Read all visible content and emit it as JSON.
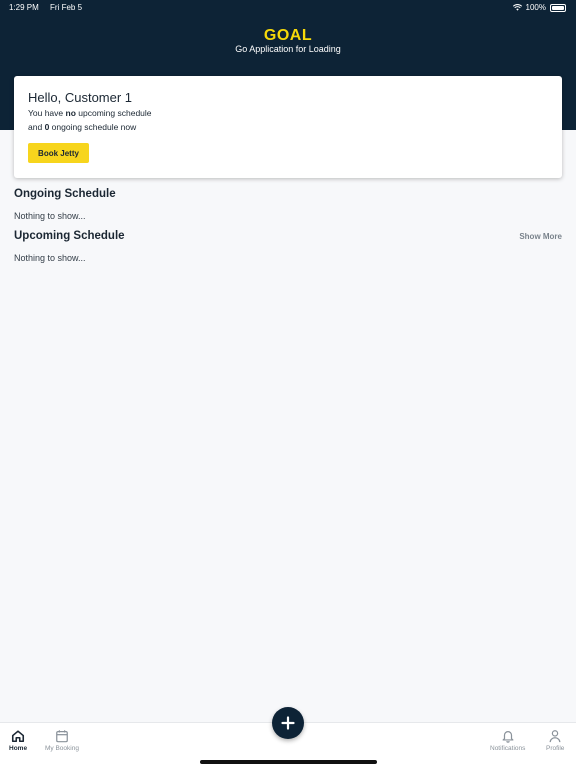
{
  "status_bar": {
    "time": "1:29 PM",
    "date": "Fri Feb 5",
    "battery": "100%"
  },
  "header": {
    "title": "GOAL",
    "subtitle": "Go Application for Loading"
  },
  "greeting_card": {
    "greeting": "Hello, Customer 1",
    "line1_prefix": "You have",
    "line1_bold": "no",
    "line1_suffix": "upcoming schedule",
    "line2_prefix": "and",
    "line2_bold": "0",
    "line2_suffix": "ongoing schedule now",
    "button_label": "Book Jetty"
  },
  "ongoing": {
    "title": "Ongoing Schedule",
    "empty_text": "Nothing to show..."
  },
  "upcoming": {
    "title": "Upcoming Schedule",
    "show_more": "Show More",
    "empty_text": "Nothing to show..."
  },
  "tabbar": {
    "home": "Home",
    "my_booking": "My Booking",
    "notifications": "Notifications",
    "profile": "Profile"
  },
  "colors": {
    "header_bg": "#0d2336",
    "accent": "#f7d51d",
    "title_yellow": "#f5d90a"
  },
  "icons": [
    "wifi-icon",
    "battery-icon",
    "home-icon",
    "calendar-icon",
    "plus-icon",
    "bell-icon",
    "person-icon"
  ]
}
